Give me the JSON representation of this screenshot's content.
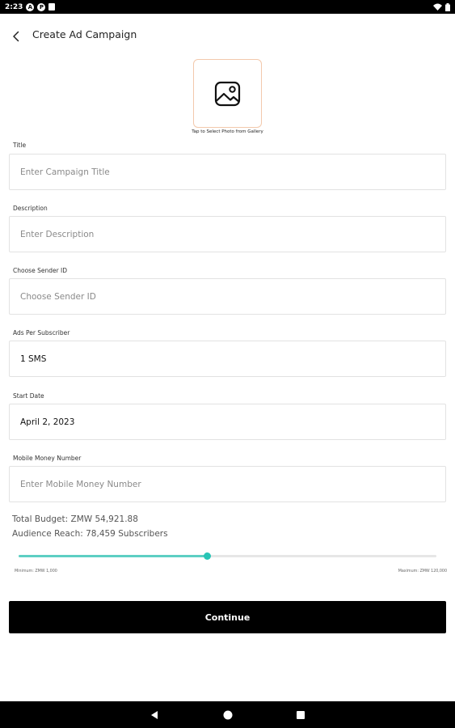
{
  "status_bar": {
    "time": "2:23",
    "notif_a": "A",
    "notif_p": "P",
    "wifi_icon": "wifi-icon",
    "battery_icon": "battery-icon"
  },
  "header": {
    "title": "Create Ad Campaign"
  },
  "photo": {
    "hint": "Tap to Select Photo from Gallery"
  },
  "form": {
    "title_label": "Title",
    "title_placeholder": "Enter Campaign Title",
    "description_label": "Description",
    "description_placeholder": "Enter Description",
    "sender_label": "Choose Sender ID",
    "sender_placeholder": "Choose Sender ID",
    "ads_label": "Ads Per Subscriber",
    "ads_value": "1 SMS",
    "start_label": "Start Date",
    "start_value": "April 2, 2023",
    "mobile_label": "Mobile Money Number",
    "mobile_placeholder": "Enter Mobile Money Number"
  },
  "summary": {
    "budget": "Total Budget: ZMW 54,921.88",
    "reach": "Audience Reach: 78,459 Subscribers"
  },
  "slider": {
    "min_label": "Minimum: ZMW 1,000",
    "max_label": "Maximum: ZMW 120,000",
    "level_fraction": 0.45
  },
  "actions": {
    "continue_label": "Continue"
  },
  "colors": {
    "accent": "#27c5b6",
    "photo_border": "#f3c9ac",
    "button_bg": "#000000"
  }
}
